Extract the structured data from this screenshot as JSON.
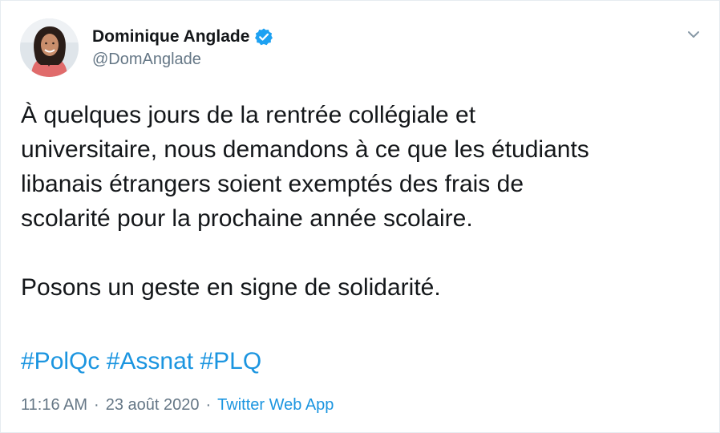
{
  "author": {
    "display_name": "Dominique Anglade",
    "handle": "@DomAnglade",
    "verified": true
  },
  "tweet": {
    "lines": [
      "À quelques jours de la rentrée collégiale et",
      "universitaire, nous demandons à ce que les étudiants",
      "libanais étrangers soient exemptés des frais de",
      "scolarité pour la prochaine année scolaire."
    ],
    "line2": "Posons un geste en signe de solidarité.",
    "hashtags": [
      "#PolQc",
      "#Assnat",
      "#PLQ"
    ]
  },
  "meta": {
    "time": "11:16 AM",
    "separator": "·",
    "date": "23 août 2020",
    "source": "Twitter Web App"
  },
  "icons": {
    "verified": "verified-badge-icon",
    "caret": "chevron-down-icon",
    "avatar": "profile-photo"
  },
  "colors": {
    "link": "#1b95e0",
    "muted": "#657786",
    "text": "#14171a",
    "verified": "#1da1f2"
  }
}
